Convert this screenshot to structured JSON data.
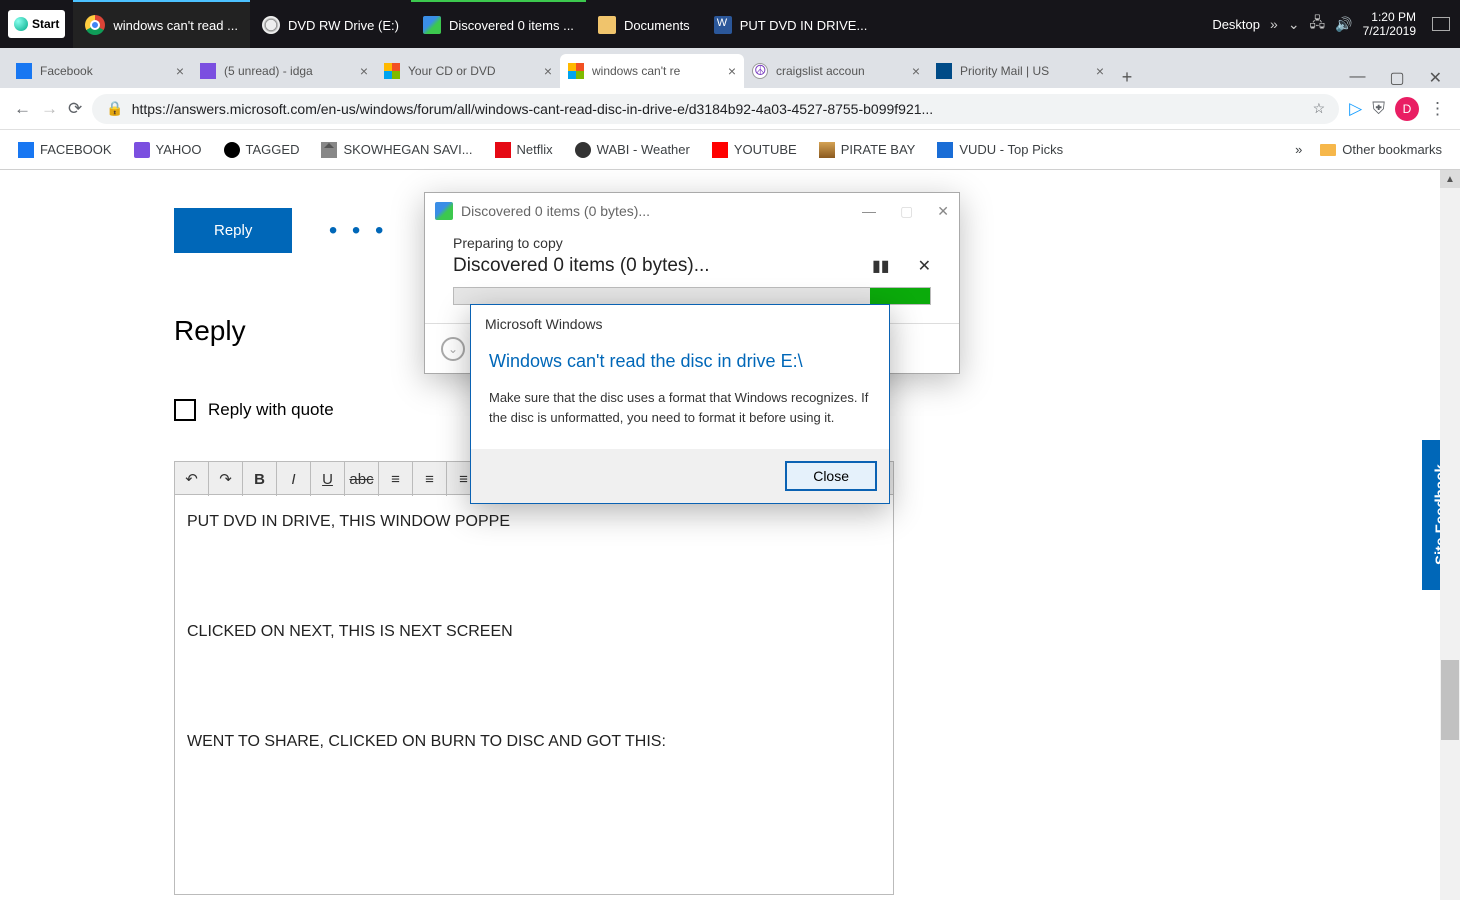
{
  "taskbar": {
    "start": "Start",
    "items": [
      {
        "label": "windows can't read ..."
      },
      {
        "label": "DVD RW Drive (E:)"
      },
      {
        "label": "Discovered 0 items ..."
      },
      {
        "label": "Documents"
      },
      {
        "label": "PUT DVD IN DRIVE..."
      }
    ],
    "right_label": "Desktop",
    "time": "1:20 PM",
    "date": "7/21/2019"
  },
  "chrome": {
    "tabs": [
      {
        "label": "Facebook"
      },
      {
        "label": "(5 unread) - idga"
      },
      {
        "label": "Your CD or DVD"
      },
      {
        "label": "windows can't re"
      },
      {
        "label": "craigslist accoun"
      },
      {
        "label": "Priority Mail | US"
      }
    ]
  },
  "addr": {
    "url": "https://answers.microsoft.com/en-us/windows/forum/all/windows-cant-read-disc-in-drive-e/d3184b92-4a03-4527-8755-b099f921...",
    "avatar": "D"
  },
  "bookmarks": {
    "items": [
      "FACEBOOK",
      "YAHOO",
      "TAGGED",
      "SKOWHEGAN SAVI...",
      "Netflix",
      "WABI - Weather",
      "YOUTUBE",
      "PIRATE BAY",
      "VUDU - Top Picks"
    ],
    "other": "Other bookmarks"
  },
  "page": {
    "reply_btn": "Reply",
    "reply_heading": "Reply",
    "quote_check": "Reply with quote",
    "body_lines": [
      "PUT DVD IN DRIVE, THIS WINDOW POPPE",
      "CLICKED ON NEXT, THIS IS NEXT SCREEN",
      "WENT TO SHARE, CLICKED ON BURN TO DISC AND GOT THIS:"
    ],
    "site_feedback": "Site Feedback"
  },
  "copy_dialog": {
    "title": "Discovered 0 items (0 bytes)...",
    "preparing": "Preparing to copy",
    "discovered": "Discovered 0 items (0 bytes)..."
  },
  "error_dialog": {
    "title": "Microsoft Windows",
    "headline": "Windows can't read the disc in drive E:\\",
    "text": "Make sure that the disc uses a format that Windows recognizes. If the disc is unformatted, you need to format it before using it.",
    "close": "Close"
  }
}
